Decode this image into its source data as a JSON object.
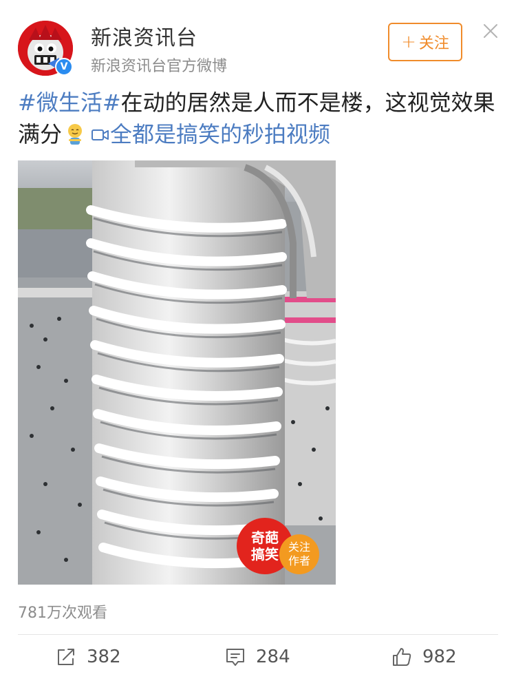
{
  "account": {
    "name": "新浪资讯台",
    "subtitle": "新浪资讯台官方微博",
    "avatar_icon": "sina-mascot-avatar",
    "verified_mark": "V"
  },
  "follow_button": {
    "label": "关注",
    "icon": "plus-icon",
    "color": "#f08b2a"
  },
  "close_icon": "close-icon",
  "post": {
    "topic": "#微生活#",
    "text_main": "在动的居然是人而不是楼，这视觉效果满分",
    "emoji": "smiling-face-emoji",
    "video_link_icon": "video-camera-icon",
    "video_link_text": "全都是搞笑的秒拍视频",
    "link_color": "#4c7cc1"
  },
  "video": {
    "badge_line1": "奇葩",
    "badge_line2": "搞笑",
    "follow_line1": "关注",
    "follow_line2": "作者"
  },
  "stats": {
    "views": "781万次观看",
    "repost_count": "382",
    "comment_count": "284",
    "like_count": "982"
  }
}
